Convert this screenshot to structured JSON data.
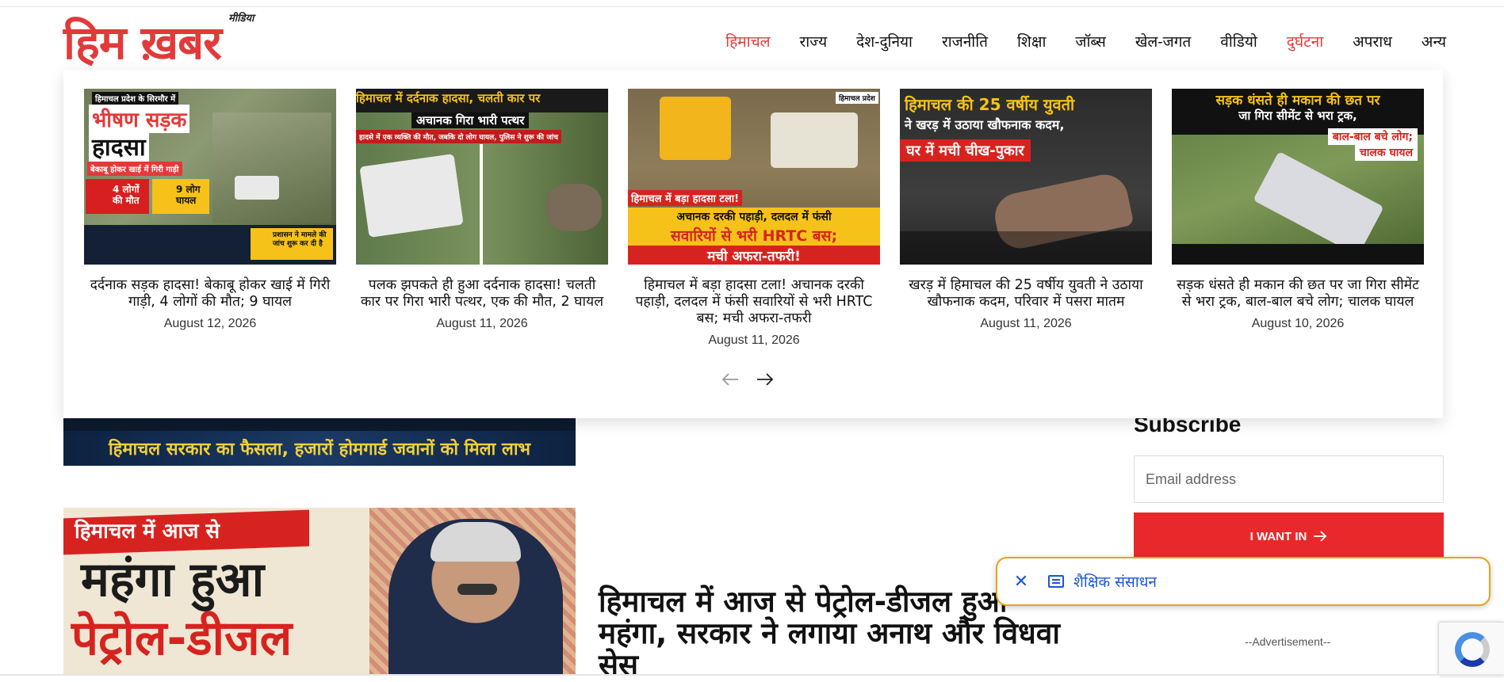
{
  "header": {
    "logo_text": "हिम ख़बर",
    "logo_sub": "मीडिया",
    "nav": [
      "हिमाचल",
      "राज्य",
      "देश-दुनिया",
      "राजनीति",
      "शिक्षा",
      "जॉब्स",
      "खेल-जगत",
      "वीडियो",
      "दुर्घटना",
      "अपराध",
      "अन्य"
    ],
    "active_nav": "हिमाचल",
    "highlighted_nav": "दुर्घटना"
  },
  "mega_menu": {
    "cards": [
      {
        "title": "दर्दनाक सड़क हादसा! बेकाबू होकर खाई में गिरी गाड़ी, 4 लोगों की मौत; 9 घायल",
        "date": "August 12, 2026",
        "thumb_lines": [
          "हिमाचल प्रदेश के सिरमौर में",
          "भीषण सड़क",
          "हादसा",
          "बेकाबू होकर खाई में गिरी गाड़ी",
          "4 लोगों की मौत",
          "9 लोग घायल",
          "प्रशासन ने मामले की जांच शुरू कर दी है"
        ]
      },
      {
        "title": "पलक झपकते ही हुआ दर्दनाक हादसा! चलती कार पर गिरा भारी पत्थर, एक की मौत, 2 घायल",
        "date": "August 11, 2026",
        "thumb_lines": [
          "हिमाचल में दर्दनाक हादसा, चलती कार पर",
          "अचानक गिरा भारी पत्थर",
          "हादसे में एक व्यक्ति की मौत, जबकि दो लोग घायल, पुलिस ने शुरू की जांच"
        ]
      },
      {
        "title": "हिमाचल में बड़ा हादसा टला! अचानक दरकी पहाड़ी, दलदल में फंसी सवारियों से भरी HRTC बस; मची अफरा-तफरी",
        "date": "August 11, 2026",
        "thumb_lines": [
          "हिमाचल में बड़ा हादसा टला!",
          "अचानक दरकी पहाड़ी, दलदल में फंसी",
          "सवारियों से भरी HRTC बस;",
          "मची अफरा-तफरी!",
          "हिमाचल प्रदेश"
        ]
      },
      {
        "title": "खरड़ में हिमाचल की 25 वर्षीय युवती ने उठाया खौफनाक कदम, परिवार में पसरा मातम",
        "date": "August 11, 2026",
        "thumb_lines": [
          "हिमाचल की 25 वर्षीय युवती",
          "ने खरड़ में उठाया खौफनाक कदम,",
          "घर में मची चीख-पुकार"
        ]
      },
      {
        "title": "सड़क धंसते ही मकान की छत पर जा गिरा सीमेंट से भरा ट्रक, बाल-बाल बचे लोग; चालक घायल",
        "date": "August 10, 2026",
        "thumb_lines": [
          "सड़क धंसते ही मकान की छत पर",
          "जा गिरा सीमेंट से भरा ट्रक,",
          "बाल-बाल बचे लोग;",
          "चालक घायल"
        ]
      }
    ],
    "prev_icon": "chevron-left-icon",
    "next_icon": "chevron-right-icon"
  },
  "page": {
    "image1_caption": "हिमाचल सरकार का फैसला, हजारों होमगार्ड जवानों को मिला लाभ",
    "image2_lines": [
      "हिमाचल में आज से",
      "महंगा हुआ",
      "पेट्रोल-डीजल"
    ],
    "headline": "हिमाचल में आज से पेट्रोल-डीजल हुआ महंगा, सरकार ने लगाया अनाथ और विधवा सेस"
  },
  "sidebar": {
    "subscribe_title": "Subscribe",
    "email_placeholder": "Email address",
    "cta_label": "I WANT IN",
    "ad_label": "--Advertisement--"
  },
  "chip": {
    "label": "शैक्षिक संसाधन"
  },
  "colors": {
    "accent": "#e23a3a",
    "button": "#e8282b",
    "chip_border": "#e8a317",
    "chip_text": "#1a56d6"
  }
}
